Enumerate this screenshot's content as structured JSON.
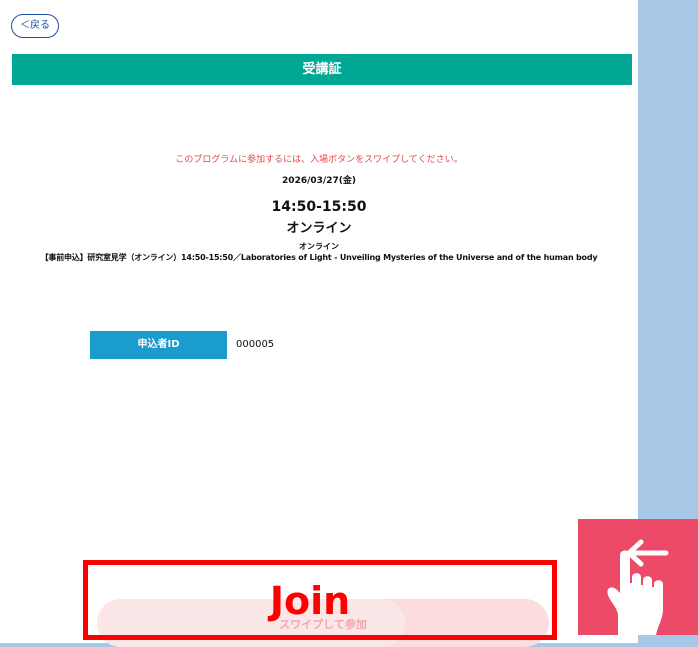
{
  "header": {
    "back_label": "＜戻る",
    "title": "受講証"
  },
  "ticket": {
    "notice": "このプログラムに参加するには、入場ボタンをスワイプしてください。",
    "date": "2026/03/27(金)",
    "time": "14:50-15:50",
    "venue": "オンライン",
    "venue_sub": "オンライン",
    "program_title": "【事前申込】研究室見学（オンライン）14:50-15:50／Laboratories of Light - Unveiling Mysteries of the Universe and of the human body"
  },
  "applicant": {
    "id_label": "申込者ID",
    "id_value": "000005"
  },
  "swipe": {
    "label": "スワイプして参加",
    "overlay_text": "Join"
  },
  "colors": {
    "title_bar": "#00a795",
    "id_label_bg": "#1a9ccf",
    "notice_text": "#e5484d",
    "highlight": "#ff0000",
    "hand_bg": "#ed4a68"
  },
  "icons": {
    "swipe_hint": "swipe-left-hand-icon"
  }
}
